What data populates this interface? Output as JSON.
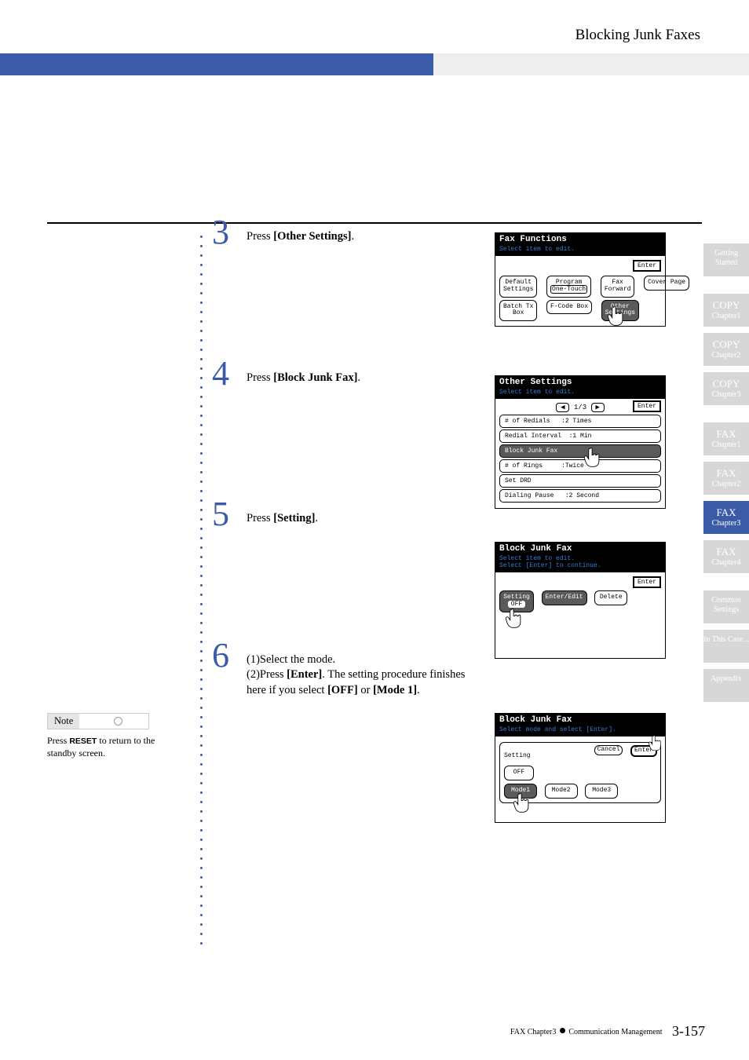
{
  "header": {
    "title": "Blocking Junk Faxes"
  },
  "steps": {
    "s3": {
      "num": "3",
      "text_a": "Press ",
      "text_b": "[Other Settings]",
      "text_c": "."
    },
    "s4": {
      "num": "4",
      "text_a": "Press ",
      "text_b": "[Block Junk Fax]",
      "text_c": "."
    },
    "s5": {
      "num": "5",
      "text_a": "Press ",
      "text_b": "[Setting]",
      "text_c": "."
    },
    "s6": {
      "num": "6",
      "line1": "(1)Select the mode.",
      "line2a": "(2)Press ",
      "line2b": "[Enter]",
      "line2c": ". The setting procedure finishes here if you select ",
      "line2d": "[OFF]",
      "line2e": " or ",
      "line2f": "[Mode 1]",
      "line2g": "."
    }
  },
  "note": {
    "label": "Note",
    "text_a": "Press ",
    "text_b": "RESET",
    "text_c": " to return to the standby screen."
  },
  "tabs": [
    {
      "big": "",
      "small": "Getting Started"
    },
    {
      "big": "COPY",
      "small": "Chapter1"
    },
    {
      "big": "COPY",
      "small": "Chapter2"
    },
    {
      "big": "COPY",
      "small": "Chapter3"
    },
    {
      "big": "FAX",
      "small": "Chapter1"
    },
    {
      "big": "FAX",
      "small": "Chapter2"
    },
    {
      "big": "FAX",
      "small": "Chapter3"
    },
    {
      "big": "FAX",
      "small": "Chapter4"
    },
    {
      "big": "",
      "small": "Common Settings"
    },
    {
      "big": "",
      "small": "In This Case..."
    },
    {
      "big": "",
      "small": "Appendix"
    }
  ],
  "active_tab_index": 6,
  "screen1": {
    "title": "Fax Functions",
    "sub": "Select item to edit.",
    "enter": "Enter",
    "buttons_row1": [
      {
        "t1": "Default",
        "t2": "Settings"
      },
      {
        "t1": "Program",
        "t2": "One-Touch"
      },
      {
        "t1": "Fax",
        "t2": "Forward"
      },
      {
        "t1": "Cover Page",
        "t2": ""
      }
    ],
    "buttons_row2": [
      {
        "t1": "Batch Tx",
        "t2": "Box"
      },
      {
        "t1": "F-Code Box",
        "t2": ""
      },
      {
        "t1": "Other",
        "t2": "Settings",
        "dark": true
      }
    ]
  },
  "screen2": {
    "title": "Other Settings",
    "sub": "Select item to edit.",
    "pager": "1/3",
    "enter": "Enter",
    "rows": [
      {
        "label": "# of Redials",
        "val": ":2 Times"
      },
      {
        "label": "Redial Interval",
        "val": ":1 Min"
      },
      {
        "label": "Block Junk Fax",
        "val": "",
        "dark": true
      },
      {
        "label": "# of Rings",
        "val": ":Twice"
      },
      {
        "label": "Set DRD",
        "val": ""
      },
      {
        "label": "Dialing Pause",
        "val": ":2 Second"
      }
    ]
  },
  "screen3": {
    "title": "Block Junk Fax",
    "sub1": "Select item to edit.",
    "sub2": "Select [Enter] to continue.",
    "enter": "Enter",
    "setting_label": "Setting",
    "setting_val": "OFF",
    "btns": [
      "Enter/Edit",
      "Delete"
    ]
  },
  "screen4": {
    "title": "Block Junk Fax",
    "sub": "Select mode and select [Enter].",
    "panel_label": "Setting",
    "cancel": "Cancel",
    "enter": "Enter",
    "off": "OFF",
    "modes": [
      "Mode1",
      "Mode2",
      "Mode3"
    ]
  },
  "footer": {
    "section": "FAX Chapter3",
    "chapter": "Communication Management",
    "page": "3-157"
  }
}
